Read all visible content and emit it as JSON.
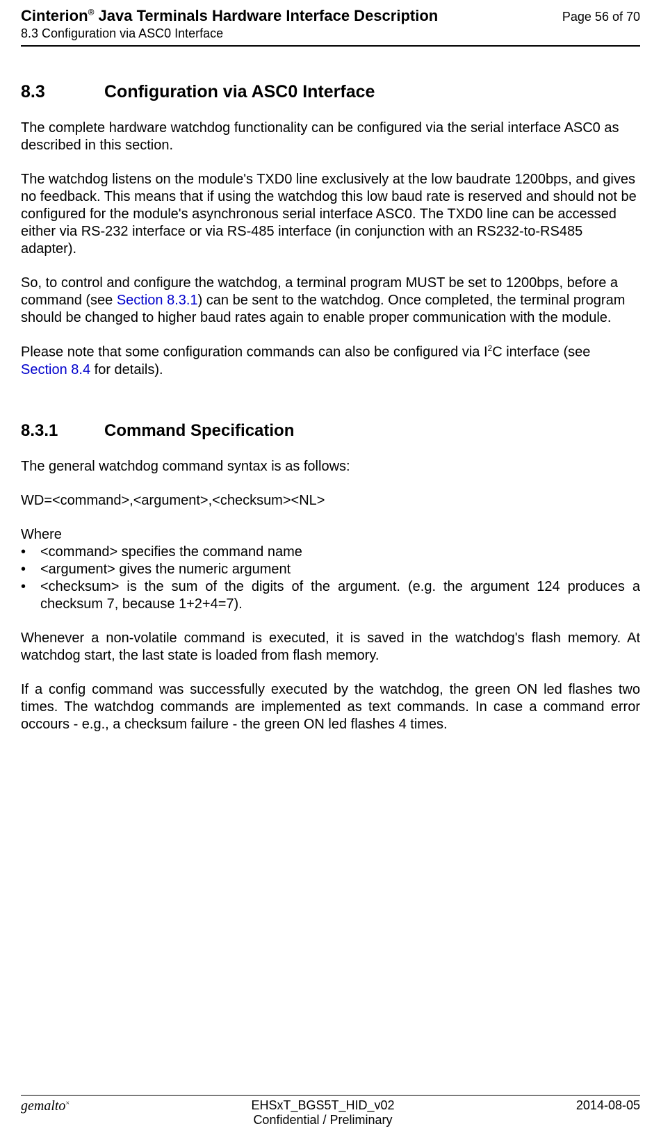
{
  "header": {
    "doc_title_pre": "Cinterion",
    "doc_title_reg": "®",
    "doc_title_post": " Java Terminals Hardware Interface Description",
    "breadcrumb": "8.3 Configuration via ASC0 Interface",
    "page_indicator": "Page 56 of 70"
  },
  "section": {
    "number": "8.3",
    "title": "Configuration via ASC0 Interface",
    "p1": "The complete hardware watchdog functionality can be configured via the serial interface ASC0 as described in this section.",
    "p2": "The watchdog listens on the module's TXD0 line exclusively at the low baudrate 1200bps, and gives no feedback. This means that if using the watchdog this low baud rate is reserved and should not be configured for the module's asynchronous serial interface ASC0. The TXD0 line can be accessed either via RS-232 interface or via RS-485 interface (in conjunction with an RS232-to-RS485 adapter).",
    "p3_a": "So, to control and configure the watchdog, a terminal program MUST be set to 1200bps, before a command (see ",
    "p3_link": "Section 8.3.1",
    "p3_b": ") can be sent to the watchdog. Once completed, the terminal program should be changed to higher baud rates again to enable proper communication with the module.",
    "p4_a": "Please note that some configuration commands can also be configured via I",
    "p4_sup": "2",
    "p4_b": "C interface (see ",
    "p4_link": "Section 8.4",
    "p4_c": " for details)."
  },
  "subsection": {
    "number": "8.3.1",
    "title": "Command Specification",
    "intro": "The general watchdog command syntax is as follows:",
    "syntax": "WD=<command>,<argument>,<checksum><NL>",
    "where_label": "Where",
    "bullets": [
      "<command> specifies the command name",
      "<argument> gives the numeric argument",
      "<checksum> is the sum of the digits of the argument. (e.g. the argument 124 produces a checksum 7, because 1+2+4=7)."
    ],
    "p_nv": "Whenever a non-volatile command is executed, it is saved in the watchdog's flash memory. At watchdog start, the last state is loaded from flash memory.",
    "p_led": "If a config command was successfully executed by the watchdog, the green ON led flashes two times. The watchdog commands are implemented as text commands. In case a command error occours - e.g., a checksum failure - the green ON led flashes 4 times."
  },
  "footer": {
    "brand_main": "gemalto",
    "brand_sup": "×",
    "doc_id": "EHSxT_BGS5T_HID_v02",
    "confidentiality": "Confidential / Preliminary",
    "date": "2014-08-05"
  }
}
